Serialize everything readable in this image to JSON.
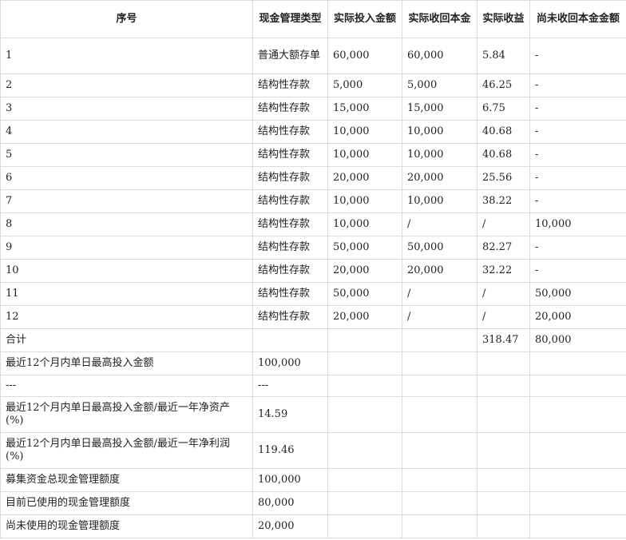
{
  "headers": [
    "序号",
    "现金管理类型",
    "实际投入金额",
    "实际收回本金",
    "实际收益",
    "尚未收回本金金额"
  ],
  "rows": [
    [
      "1",
      "普通大额存单",
      "60,000",
      "60,000",
      "5.84",
      "-"
    ],
    [
      "2",
      "结构性存款",
      "5,000",
      "5,000",
      "46.25",
      "-"
    ],
    [
      "3",
      "结构性存款",
      "15,000",
      "15,000",
      "6.75",
      "-"
    ],
    [
      "4",
      "结构性存款",
      "10,000",
      "10,000",
      "40.68",
      "-"
    ],
    [
      "5",
      "结构性存款",
      "10,000",
      "10,000",
      "40.68",
      "-"
    ],
    [
      "6",
      "结构性存款",
      "20,000",
      "20,000",
      "25.56",
      "-"
    ],
    [
      "7",
      "结构性存款",
      "10,000",
      "10,000",
      "38.22",
      "-"
    ],
    [
      "8",
      "结构性存款",
      "10,000",
      "/",
      "/",
      "10,000"
    ],
    [
      "9",
      "结构性存款",
      "50,000",
      "50,000",
      "82.27",
      "-"
    ],
    [
      "10",
      "结构性存款",
      "20,000",
      "20,000",
      "32.22",
      "-"
    ],
    [
      "11",
      "结构性存款",
      "50,000",
      "/",
      "/",
      "50,000"
    ],
    [
      "12",
      "结构性存款",
      "20,000",
      "/",
      "/",
      "20,000"
    ],
    [
      "合计",
      "",
      "",
      "",
      "318.47",
      "80,000"
    ]
  ],
  "summary": [
    [
      "最近12个月内单日最高投入金额",
      "100,000"
    ],
    [
      "---",
      "---"
    ],
    [
      "最近12个月内单日最高投入金额/最近一年净资产(%)",
      "14.59"
    ],
    [
      "最近12个月内单日最高投入金额/最近一年净利润(%)",
      "119.46"
    ],
    [
      "募集资金总现金管理额度",
      "100,000"
    ],
    [
      "目前已使用的现金管理额度",
      "80,000"
    ],
    [
      "尚未使用的现金管理额度",
      "20,000"
    ]
  ]
}
